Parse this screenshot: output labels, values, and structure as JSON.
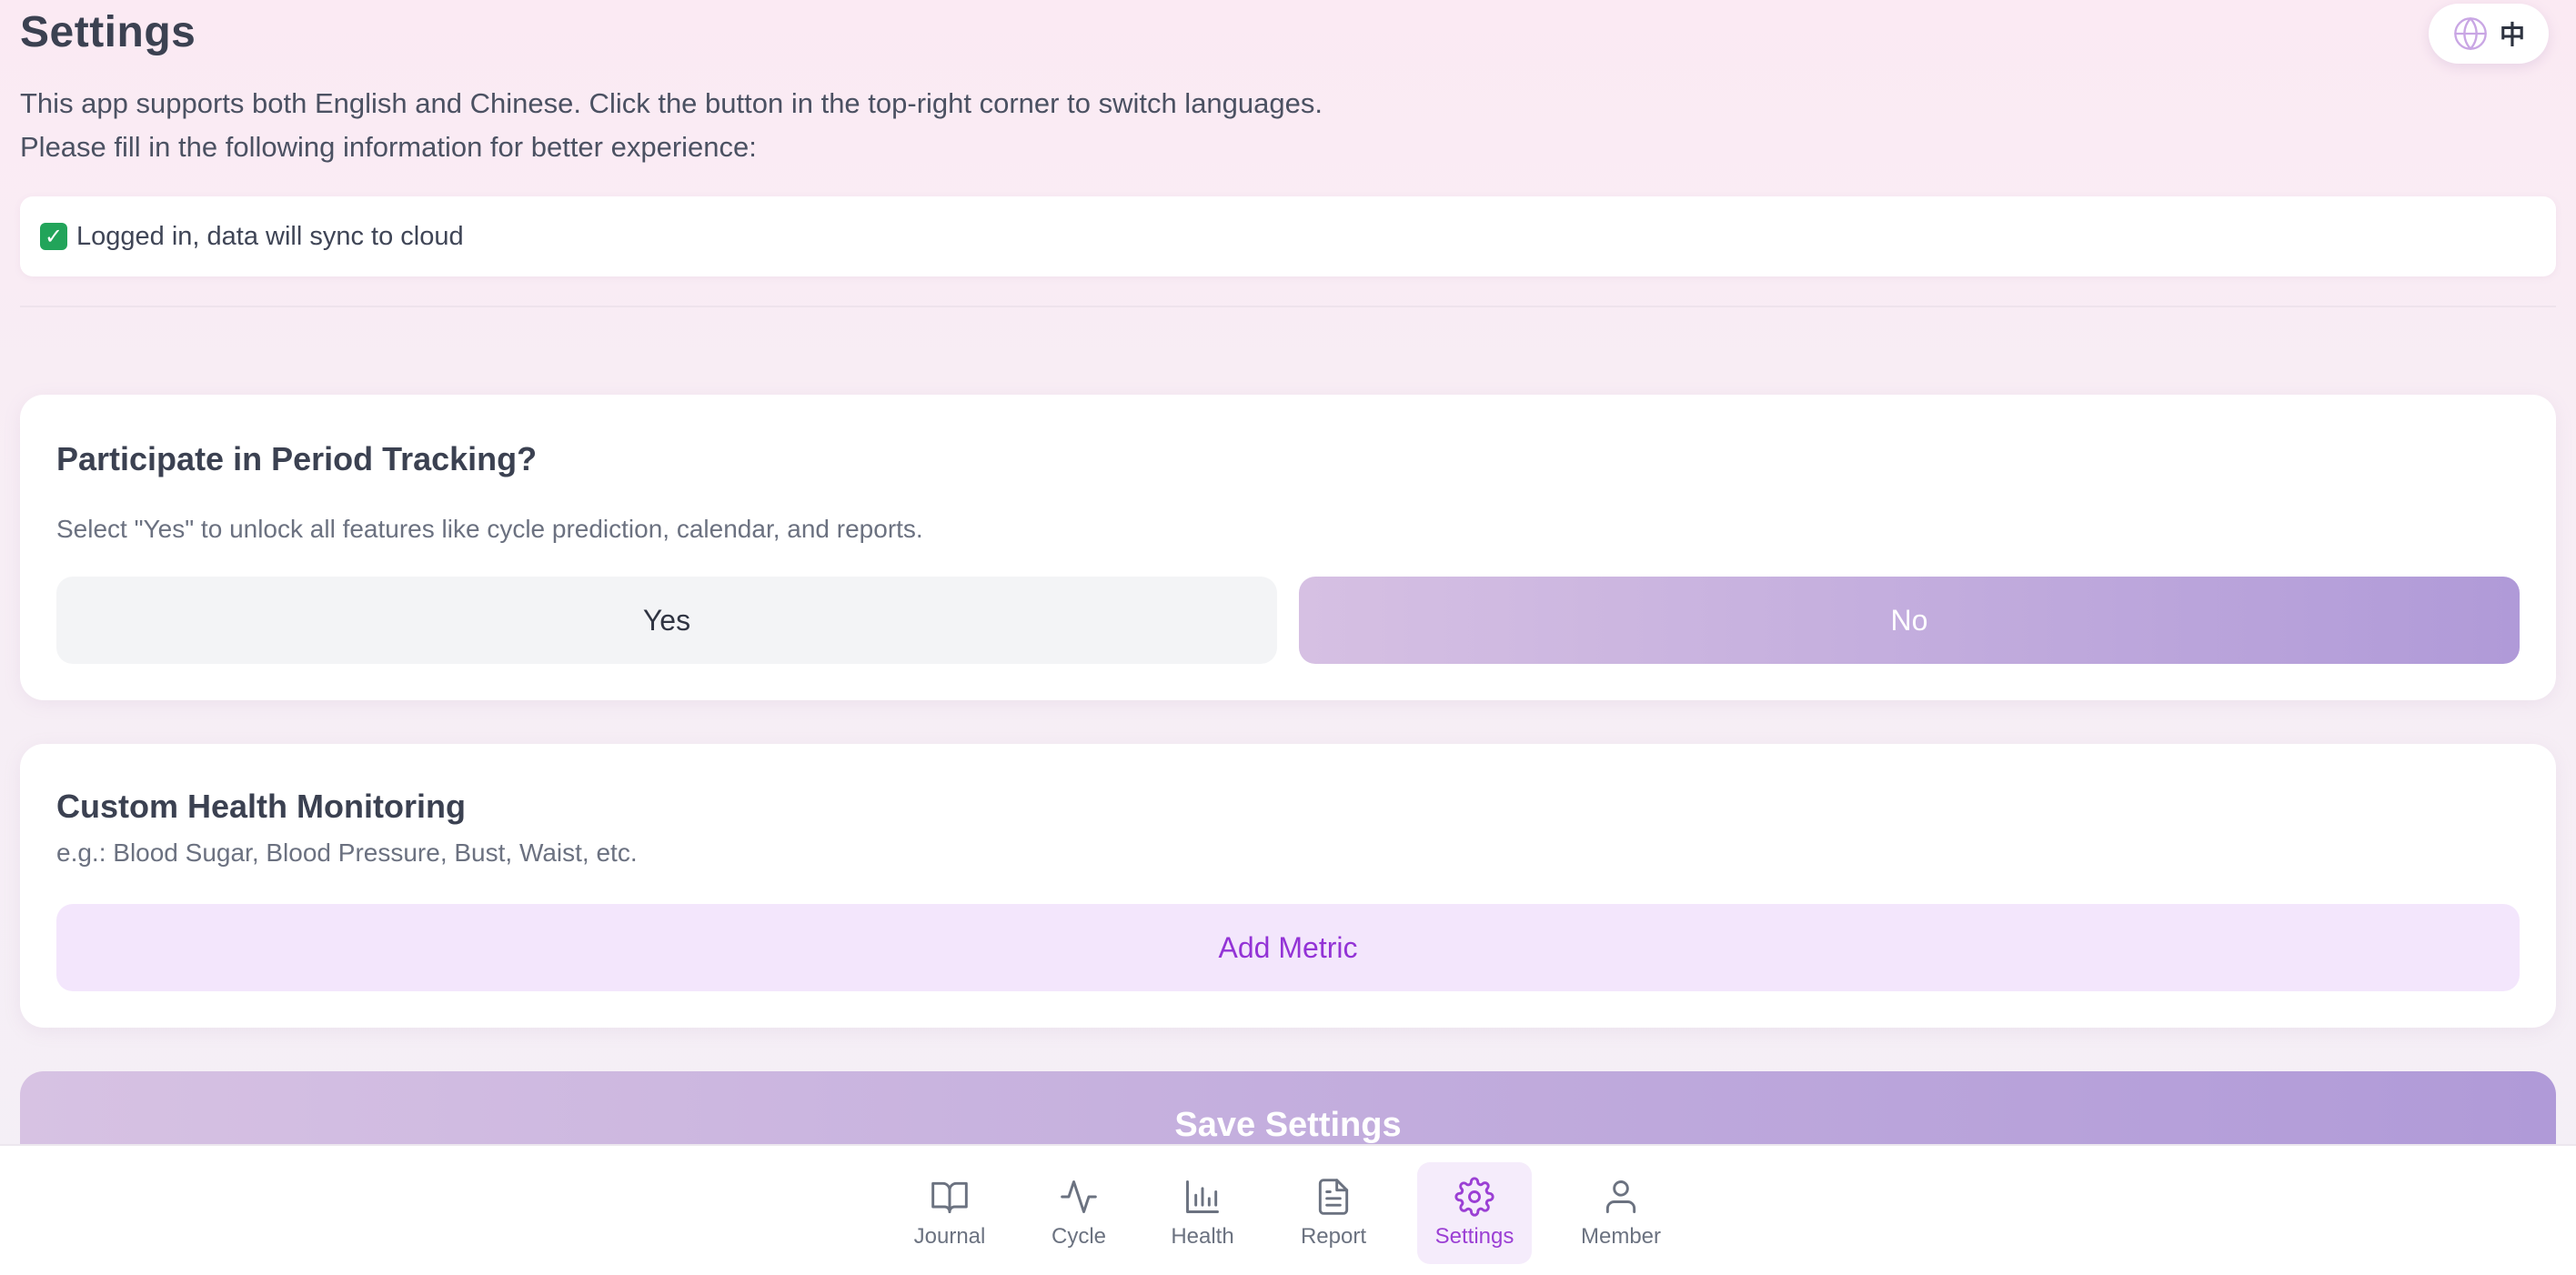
{
  "header": {
    "title": "Settings",
    "intro_line1": "This app supports both English and Chinese. Click the button in the top-right corner to switch languages.",
    "intro_line2": "Please fill in the following information for better experience:",
    "language_toggle": {
      "label": "中",
      "icon": "globe-icon"
    }
  },
  "login_status": {
    "icon": "check-mark-icon",
    "text": "Logged in, data will sync to cloud"
  },
  "period_tracking": {
    "title": "Participate in Period Tracking?",
    "description": "Select \"Yes\" to unlock all features like cycle prediction, calendar, and reports.",
    "yes_label": "Yes",
    "no_label": "No",
    "selected": "No"
  },
  "health_monitoring": {
    "title": "Custom Health Monitoring",
    "description": "e.g.: Blood Sugar, Blood Pressure, Bust, Waist, etc.",
    "add_label": "Add Metric"
  },
  "save": {
    "label": "Save Settings"
  },
  "bottom_nav": {
    "active": "Settings",
    "items": [
      {
        "label": "Journal",
        "icon": "book-open-icon"
      },
      {
        "label": "Cycle",
        "icon": "activity-icon"
      },
      {
        "label": "Health",
        "icon": "bar-chart-icon"
      },
      {
        "label": "Report",
        "icon": "document-icon"
      },
      {
        "label": "Settings",
        "icon": "gear-icon"
      },
      {
        "label": "Member",
        "icon": "user-icon"
      }
    ]
  },
  "colors": {
    "accent_purple": "#9b3fd4",
    "gradient_start": "#d6c0e3",
    "gradient_end": "#b09ad8",
    "status_check": "#22a45a"
  }
}
